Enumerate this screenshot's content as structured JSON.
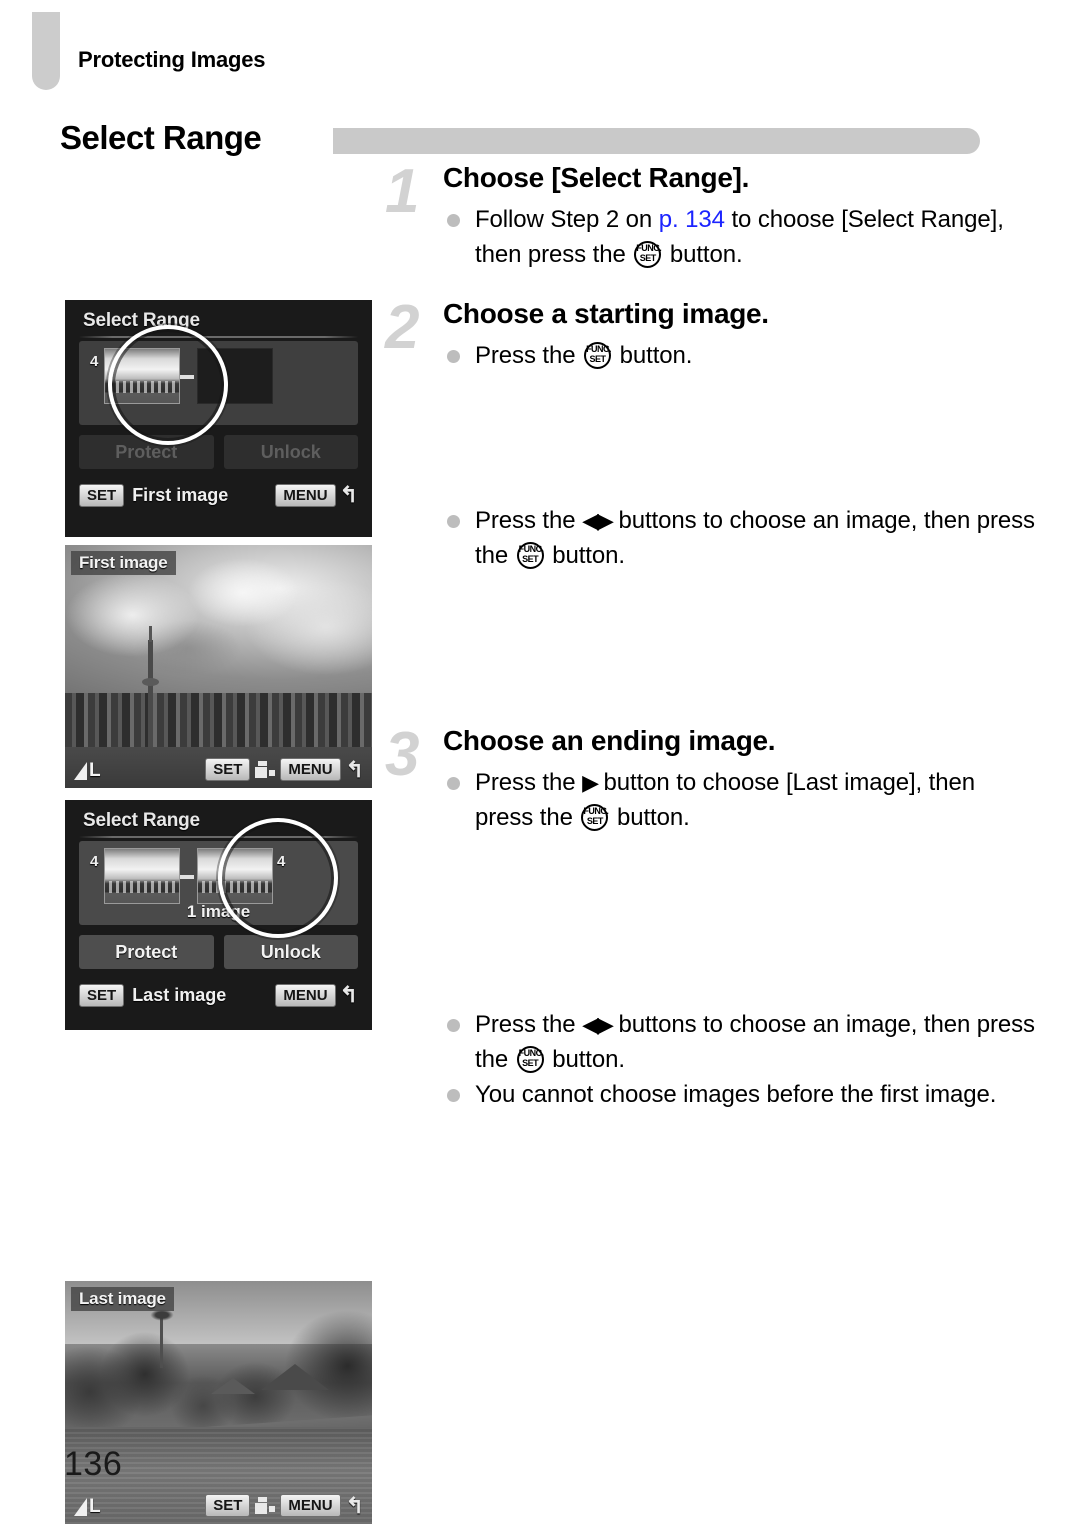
{
  "header": {
    "chapter": "Protecting Images"
  },
  "section": {
    "title": "Select Range"
  },
  "page_number": "136",
  "icons": {
    "funcset_top": "FUNC.",
    "funcset_bottom": "SET",
    "left_right_arrows": "◀▶",
    "right_arrow": "▶",
    "return_arrow": "↰"
  },
  "steps": [
    {
      "number": "1",
      "title": "Choose [Select Range].",
      "bullets": [
        {
          "pre": "Follow Step 2 on ",
          "link": "p. 134",
          "mid": " to choose [Select Range], then press the ",
          "icon": "funcset",
          "post": " button."
        }
      ]
    },
    {
      "number": "2",
      "title": "Choose a starting image.",
      "bullets": [
        {
          "pre": "Press the ",
          "icon": "funcset",
          "post": " button."
        },
        {
          "pre": "Press the ",
          "icon": "arrows",
          "mid": " buttons to choose an image, then press the ",
          "icon2": "funcset",
          "post": " button."
        }
      ]
    },
    {
      "number": "3",
      "title": "Choose an ending image.",
      "bullets": [
        {
          "pre": "Press the ",
          "icon": "right-arrow",
          "mid": " button to choose [Last image], then press the ",
          "icon2": "funcset",
          "post": " button."
        },
        {
          "pre": "Press the ",
          "icon": "arrows",
          "mid": " buttons to choose an image, then press the ",
          "icon2": "funcset",
          "post": " button."
        },
        {
          "text": "You cannot choose images before the first image."
        }
      ]
    }
  ],
  "screens": [
    {
      "id": "shot1",
      "type": "menu",
      "title": "Select Range",
      "thumb_index_left": "4",
      "count_label": "",
      "buttons": [
        {
          "label": "Protect",
          "state": "disabled"
        },
        {
          "label": "Unlock",
          "state": "disabled"
        }
      ],
      "footer_badge": "SET",
      "footer_text": "First image",
      "footer_menu": "MENU"
    },
    {
      "id": "shot2",
      "type": "photo",
      "tag": "First image",
      "quality": "L",
      "footer_set": "SET",
      "footer_menu": "MENU"
    },
    {
      "id": "shot3",
      "type": "menu",
      "title": "Select Range",
      "thumb_index_left": "4",
      "thumb_index_right": "4",
      "count_label": "1 image",
      "buttons": [
        {
          "label": "Protect",
          "state": "enabled"
        },
        {
          "label": "Unlock",
          "state": "enabled"
        }
      ],
      "footer_badge": "SET",
      "footer_text": "Last image",
      "footer_menu": "MENU"
    },
    {
      "id": "shot4",
      "type": "photo",
      "tag": "Last image",
      "quality": "L",
      "footer_set": "SET",
      "footer_menu": "MENU"
    }
  ]
}
